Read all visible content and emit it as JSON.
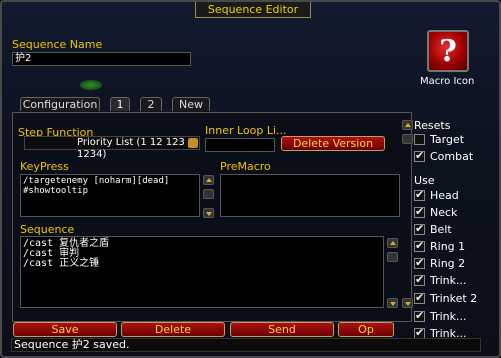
{
  "window": {
    "title": "Sequence Editor"
  },
  "sequence_name": {
    "label": "Sequence Name",
    "value": "护2"
  },
  "macro_icon": {
    "label": "Macro Icon",
    "glyph": "?"
  },
  "tabs": [
    {
      "label": "Configuration"
    },
    {
      "label": "1"
    },
    {
      "label": "2"
    },
    {
      "label": "New"
    }
  ],
  "step_function": {
    "label": "Step Function",
    "value": "Priority List (1 12 123 1234)"
  },
  "inner_loop": {
    "label": "Inner Loop Li..."
  },
  "delete_version_button": "Delete Version",
  "keypress": {
    "label": "KeyPress",
    "lines": [
      "/targetenemy [noharm][dead]",
      "#showtooltip"
    ]
  },
  "premacro": {
    "label": "PreMacro",
    "lines": []
  },
  "sequence": {
    "label": "Sequence",
    "lines": [
      "/cast 复仇者之盾",
      "/cast 审判",
      "/cast 正义之锤"
    ]
  },
  "resets": {
    "label": "Resets",
    "items": [
      {
        "label": "Target",
        "checked": false
      },
      {
        "label": "Combat",
        "checked": true
      }
    ]
  },
  "use": {
    "label": "Use",
    "items": [
      {
        "label": "Head",
        "checked": true
      },
      {
        "label": "Neck",
        "checked": true
      },
      {
        "label": "Belt",
        "checked": true
      },
      {
        "label": "Ring 1",
        "checked": true
      },
      {
        "label": "Ring 2",
        "checked": true
      },
      {
        "label": "Trink...",
        "checked": true
      },
      {
        "label": "Trinket 2",
        "checked": true
      },
      {
        "label": "Trink...",
        "checked": true
      },
      {
        "label": "Trink...",
        "checked": true
      }
    ]
  },
  "buttons": {
    "save": "Save",
    "delete": "Delete",
    "send": "Send",
    "options": "Op"
  },
  "status": "Sequence 护2 saved."
}
